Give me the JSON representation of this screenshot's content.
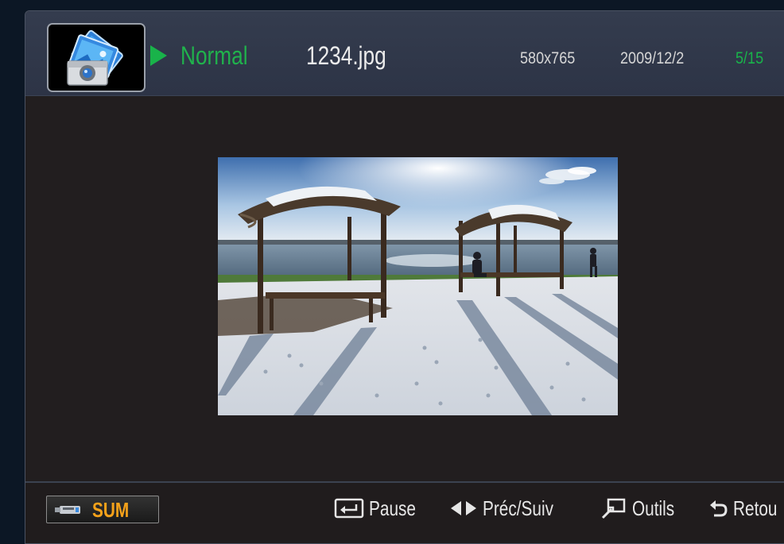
{
  "header": {
    "app_icon": "photo-camera-icon",
    "mode_label": "Normal",
    "filename": "1234.jpg",
    "resolution": "580x765",
    "date": "2009/12/2",
    "counter": "5/15"
  },
  "photo": {
    "subject": "beach with two thatched parasols"
  },
  "footer": {
    "device_label": "SUM",
    "device_icon": "usb-drive-icon",
    "actions": [
      {
        "icon": "pause-enter-icon",
        "label": "Pause"
      },
      {
        "icon": "left-right-arrows-icon",
        "label": "Préc/Suiv"
      },
      {
        "icon": "tools-icon",
        "label": "Outils"
      },
      {
        "icon": "return-icon",
        "label": "Retou"
      }
    ]
  },
  "colors": {
    "accent_green": "#19b34a",
    "sum_orange": "#f6a21a",
    "header_bg": "#2d3446",
    "content_bg": "#221e1f"
  }
}
